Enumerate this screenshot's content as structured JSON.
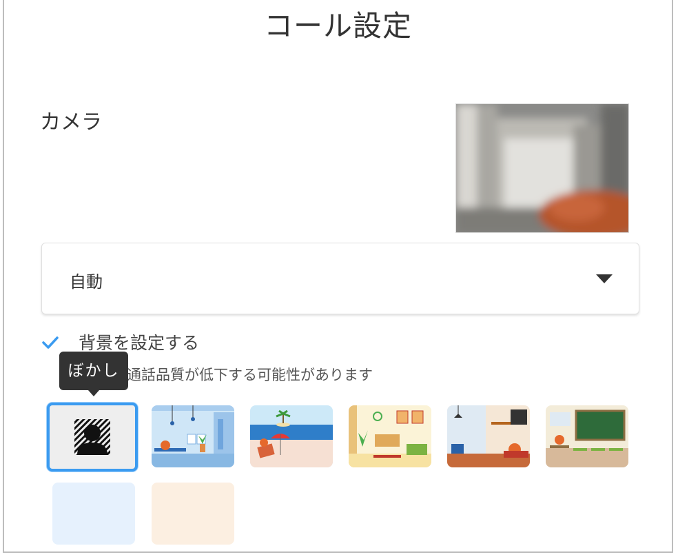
{
  "dialog": {
    "title": "コール設定"
  },
  "camera": {
    "label": "カメラ",
    "selected_device": "自動"
  },
  "background": {
    "checkbox_label": "背景を設定する",
    "checked": true,
    "warning": "通話品質が低下する可能性があります",
    "tooltip": "ぼかし",
    "options": [
      {
        "id": "blur",
        "selected": true
      },
      {
        "id": "office"
      },
      {
        "id": "beach"
      },
      {
        "id": "living-room"
      },
      {
        "id": "cafe"
      },
      {
        "id": "classroom"
      },
      {
        "id": "light-blue"
      },
      {
        "id": "light-peach"
      }
    ]
  },
  "colors": {
    "accent": "#3b9bf0",
    "text": "#333333",
    "swatch_blue": "#e6f1fd",
    "swatch_peach": "#fcefe1"
  }
}
